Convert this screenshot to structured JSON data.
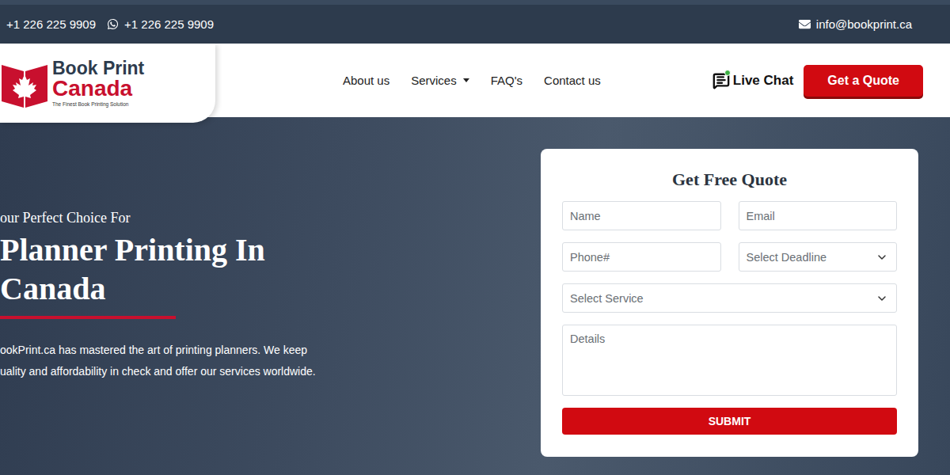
{
  "top_bar": {
    "phone": "+1 226 225 9909",
    "whatsapp": "+1 226 225 9909",
    "email": "info@bookprint.ca"
  },
  "logo": {
    "line1": "Book Print",
    "line2": "Canada",
    "tagline": "The Finest Book Printing Solution"
  },
  "nav": [
    {
      "label": "About us",
      "dropdown": false
    },
    {
      "label": "Services",
      "dropdown": true
    },
    {
      "label": "FAQ's",
      "dropdown": false
    },
    {
      "label": "Contact us",
      "dropdown": false
    }
  ],
  "live_chat": "Live Chat",
  "quote_button": "Get a Quote",
  "hero": {
    "kicker": "our Perfect Choice For",
    "title_lines": [
      "Planner Printing In",
      "Canada"
    ],
    "text_lines": [
      "ookPrint.ca has mastered the art of printing planners. We keep",
      "uality and affordability in check and offer our services worldwide."
    ]
  },
  "form": {
    "title": "Get Free Quote",
    "fields": [
      {
        "placeholder": "Name",
        "kind": "input"
      },
      {
        "placeholder": "Email",
        "kind": "input"
      },
      {
        "placeholder": "Phone#",
        "kind": "input"
      },
      {
        "placeholder": "Select Deadline",
        "kind": "select"
      },
      {
        "placeholder": "Select Service",
        "kind": "select",
        "wide": true
      },
      {
        "placeholder": "Details",
        "kind": "textarea",
        "wide": true
      }
    ],
    "submit": "SUBMIT"
  }
}
